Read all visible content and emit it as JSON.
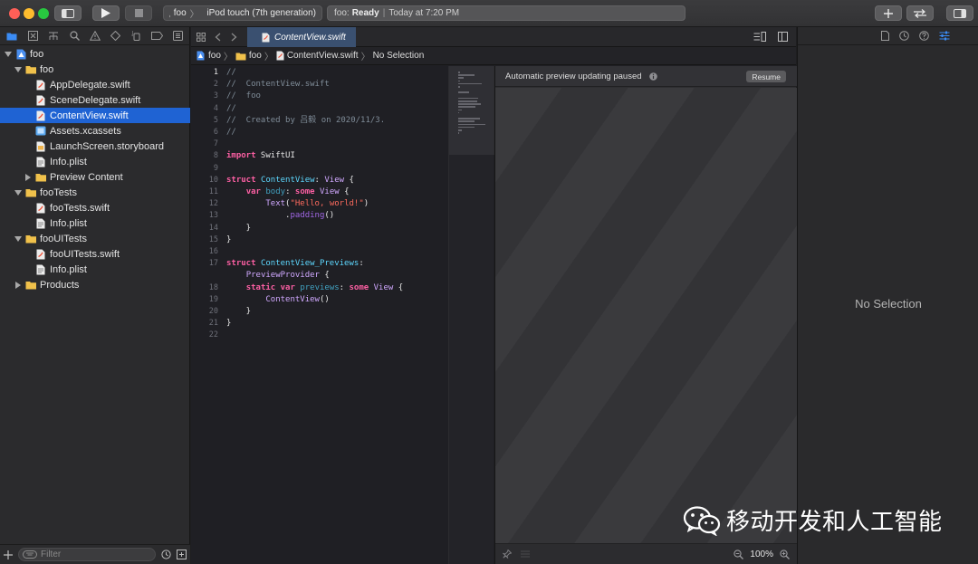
{
  "colors": {
    "toolbar_bg": "#3a3a3c",
    "selection_blue": "#1f63d3",
    "keyword": "#fc5fa3",
    "type_name": "#5dd8ff",
    "string": "#fc6a5d",
    "comment": "#7f8c98",
    "function": "#a167e6",
    "folder": "#f0c14b"
  },
  "toolbar": {
    "scheme_project": "foo",
    "scheme_device": "iPod touch (7th generation)",
    "activity_project": "foo:",
    "activity_status": "Ready",
    "activity_time": "Today at 7:20 PM"
  },
  "navigator": {
    "tree": [
      {
        "label": "foo",
        "depth": 0,
        "kind": "project",
        "open": true
      },
      {
        "label": "foo",
        "depth": 1,
        "kind": "folder",
        "open": true
      },
      {
        "label": "AppDelegate.swift",
        "depth": 2,
        "kind": "swift"
      },
      {
        "label": "SceneDelegate.swift",
        "depth": 2,
        "kind": "swift"
      },
      {
        "label": "ContentView.swift",
        "depth": 2,
        "kind": "swift",
        "selected": true
      },
      {
        "label": "Assets.xcassets",
        "depth": 2,
        "kind": "assets"
      },
      {
        "label": "LaunchScreen.storyboard",
        "depth": 2,
        "kind": "storyboard"
      },
      {
        "label": "Info.plist",
        "depth": 2,
        "kind": "plist"
      },
      {
        "label": "Preview Content",
        "depth": 2,
        "kind": "folder",
        "open": false
      },
      {
        "label": "fooTests",
        "depth": 1,
        "kind": "folder",
        "open": true
      },
      {
        "label": "fooTests.swift",
        "depth": 2,
        "kind": "swift"
      },
      {
        "label": "Info.plist",
        "depth": 2,
        "kind": "plist"
      },
      {
        "label": "fooUITests",
        "depth": 1,
        "kind": "folder",
        "open": true
      },
      {
        "label": "fooUITests.swift",
        "depth": 2,
        "kind": "swift"
      },
      {
        "label": "Info.plist",
        "depth": 2,
        "kind": "plist"
      },
      {
        "label": "Products",
        "depth": 1,
        "kind": "folder",
        "open": false
      }
    ],
    "filter_placeholder": "Filter"
  },
  "editor": {
    "tab_label": "ContentView.swift",
    "jumpbar": [
      "foo",
      "foo",
      "ContentView.swift",
      "No Selection"
    ],
    "code": [
      {
        "n": "1",
        "tokens": [
          [
            "c",
            "//"
          ]
        ]
      },
      {
        "n": "2",
        "tokens": [
          [
            "c",
            "//  ContentView.swift"
          ]
        ]
      },
      {
        "n": "3",
        "tokens": [
          [
            "c",
            "//  foo"
          ]
        ]
      },
      {
        "n": "4",
        "tokens": [
          [
            "c",
            "//"
          ]
        ]
      },
      {
        "n": "5",
        "tokens": [
          [
            "c",
            "//  Created by 吕毅 on 2020/11/3."
          ]
        ]
      },
      {
        "n": "6",
        "tokens": [
          [
            "c",
            "//"
          ]
        ]
      },
      {
        "n": "7",
        "tokens": []
      },
      {
        "n": "8",
        "tokens": [
          [
            "k",
            "import"
          ],
          [
            "p",
            " SwiftUI"
          ]
        ]
      },
      {
        "n": "9",
        "tokens": []
      },
      {
        "n": "10",
        "tokens": [
          [
            "k",
            "struct"
          ],
          [
            "p",
            " "
          ],
          [
            "t",
            "ContentView"
          ],
          [
            "p",
            ": "
          ],
          [
            "u",
            "View"
          ],
          [
            "p",
            " {"
          ]
        ]
      },
      {
        "n": "11",
        "tokens": [
          [
            "p",
            "    "
          ],
          [
            "k",
            "var"
          ],
          [
            "p",
            " "
          ],
          [
            "t",
            "body"
          ],
          [
            "p",
            ": "
          ],
          [
            "k",
            "some"
          ],
          [
            "p",
            " "
          ],
          [
            "u",
            "View"
          ],
          [
            "p",
            " {"
          ]
        ]
      },
      {
        "n": "12",
        "tokens": [
          [
            "p",
            "        "
          ],
          [
            "u",
            "Text"
          ],
          [
            "p",
            "("
          ],
          [
            "s",
            "\"Hello, world!\""
          ],
          [
            "p",
            ")"
          ]
        ]
      },
      {
        "n": "13",
        "tokens": [
          [
            "p",
            "            ."
          ],
          [
            "f",
            "padding"
          ],
          [
            "p",
            "()"
          ]
        ]
      },
      {
        "n": "14",
        "tokens": [
          [
            "p",
            "    }"
          ]
        ]
      },
      {
        "n": "15",
        "tokens": [
          [
            "p",
            "}"
          ]
        ]
      },
      {
        "n": "16",
        "tokens": []
      },
      {
        "n": "17",
        "tokens": [
          [
            "k",
            "struct"
          ],
          [
            "p",
            " "
          ],
          [
            "t",
            "ContentView_Previews"
          ],
          [
            "p",
            ":"
          ]
        ]
      },
      {
        "n": "",
        "tokens": [
          [
            "p",
            "    "
          ],
          [
            "u",
            "PreviewProvider"
          ],
          [
            "p",
            " {"
          ]
        ]
      },
      {
        "n": "18",
        "tokens": [
          [
            "p",
            "    "
          ],
          [
            "k",
            "static"
          ],
          [
            "p",
            " "
          ],
          [
            "k",
            "var"
          ],
          [
            "p",
            " "
          ],
          [
            "t",
            "previews"
          ],
          [
            "p",
            ": "
          ],
          [
            "k",
            "some"
          ],
          [
            "p",
            " "
          ],
          [
            "u",
            "View"
          ],
          [
            "p",
            " {"
          ]
        ]
      },
      {
        "n": "19",
        "tokens": [
          [
            "p",
            "        "
          ],
          [
            "u",
            "ContentView"
          ],
          [
            "p",
            "()"
          ]
        ]
      },
      {
        "n": "20",
        "tokens": [
          [
            "p",
            "    }"
          ]
        ]
      },
      {
        "n": "21",
        "tokens": [
          [
            "p",
            "}"
          ]
        ]
      },
      {
        "n": "22",
        "tokens": []
      }
    ],
    "current_line": "1"
  },
  "canvas": {
    "banner": "Automatic preview updating paused",
    "resume_label": "Resume",
    "zoom": "100%"
  },
  "inspector": {
    "empty_label": "No Selection"
  },
  "watermark": {
    "text": "移动开发和人工智能"
  }
}
